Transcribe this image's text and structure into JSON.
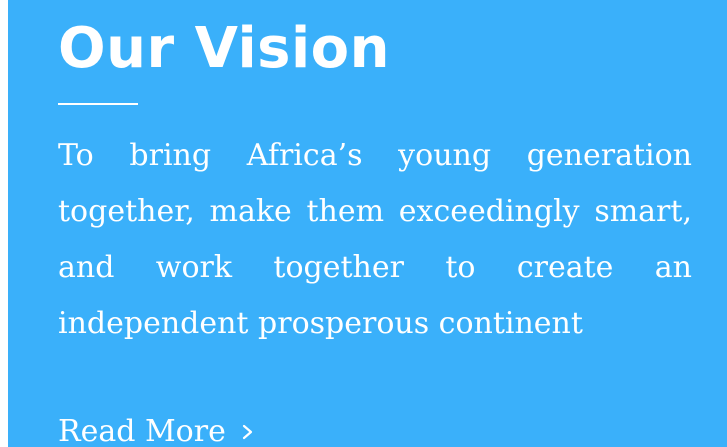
{
  "colors": {
    "card_background": "#3ab0fa",
    "text": "#ffffff"
  },
  "section": {
    "title": "Our Vision",
    "body": "To bring Africa’s young generation together, make them exceedingly smart, and work together to create an independent prosperous continent",
    "read_more_label": "Read More",
    "read_more_icon": "chevron-right-icon"
  }
}
